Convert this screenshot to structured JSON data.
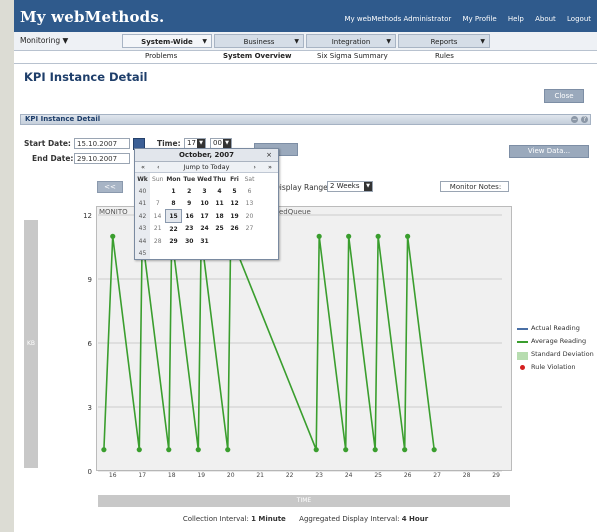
{
  "app": {
    "logo": "My webMethods.",
    "top_links": [
      "My webMethods Administrator",
      "My Profile",
      "Help",
      "About",
      "Logout"
    ]
  },
  "nav": {
    "left_menu": "Monitoring ▼",
    "tabs": [
      "System-Wide",
      "Business",
      "Integration",
      "Reports"
    ],
    "subtabs": [
      "Problems",
      "System Overview",
      "Six Sigma Summary",
      "Rules"
    ]
  },
  "page": {
    "title": "KPI Instance Detail",
    "close_label": "Close",
    "panel_title": "KPI Instance Detail"
  },
  "filters": {
    "start_label": "Start Date:",
    "start_value": "15.10.2007",
    "end_label": "End Date:",
    "end_value": "29.10.2007",
    "time_label": "Time:",
    "hour_value": "17",
    "minute_value": "00",
    "view_data_label": "View Data...",
    "prev_label": "<<",
    "display_range_label": "Display Range:",
    "display_range_value": "2 Weeks",
    "monitor_notes_label": "Monitor Notes:"
  },
  "calendar": {
    "month_title": "October, 2007",
    "close_x": "×",
    "jump_label": "Jump to Today",
    "nav_left": [
      "«",
      "‹"
    ],
    "nav_right": [
      "›",
      "»"
    ],
    "headers": [
      "Wk",
      "Sun",
      "Mon",
      "Tue",
      "Wed",
      "Thu",
      "Fri",
      "Sat"
    ],
    "weeks": [
      [
        "40",
        "",
        "1",
        "2",
        "3",
        "4",
        "5",
        "6"
      ],
      [
        "41",
        "7",
        "8",
        "9",
        "10",
        "11",
        "12",
        "13"
      ],
      [
        "42",
        "14",
        "15",
        "16",
        "17",
        "18",
        "19",
        "20"
      ],
      [
        "43",
        "21",
        "22",
        "23",
        "24",
        "25",
        "26",
        "27"
      ],
      [
        "44",
        "28",
        "29",
        "30",
        "31",
        "",
        "",
        ""
      ],
      [
        "45",
        "",
        "",
        "",
        "",
        "",
        "",
        ""
      ]
    ]
  },
  "chart": {
    "monitor_label_left": "MONITO",
    "monitor_label_right": "edQueue",
    "y_axis_title": "KB",
    "x_axis_title": "TIME",
    "legend": [
      "Actual Reading",
      "Average Reading",
      "Standard Deviation",
      "Rule Violation"
    ],
    "colors": {
      "actual": "#4a6fa5",
      "average": "#3a9e2e",
      "stddev": "#b7ddb0",
      "violation": "#d42020"
    }
  },
  "chart_data": {
    "type": "line",
    "y_ticks": [
      0,
      3,
      6,
      9,
      12
    ],
    "ylim": [
      0,
      12
    ],
    "x_ticks": [
      "16",
      "17",
      "18",
      "19",
      "20",
      "21",
      "22",
      "23",
      "24",
      "25",
      "26",
      "27",
      "28",
      "29"
    ],
    "series": [
      {
        "name": "Average Reading",
        "x": [
          15.7,
          16.0,
          16.9,
          17.0,
          17.9,
          18.0,
          18.9,
          19.0,
          19.9,
          20.0,
          22.9,
          23.0,
          23.9,
          24.0,
          24.9,
          25.0,
          25.9,
          26.0,
          26.9
        ],
        "values": [
          1,
          11,
          1,
          11,
          1,
          11,
          1,
          11,
          1,
          11,
          1,
          11,
          1,
          11,
          1,
          11,
          1,
          11,
          1
        ]
      }
    ]
  },
  "footer": {
    "collection_label": "Collection Interval:",
    "collection_value": "1 Minute",
    "aggregated_label": "Aggregated Display Interval:",
    "aggregated_value": "4 Hour"
  }
}
